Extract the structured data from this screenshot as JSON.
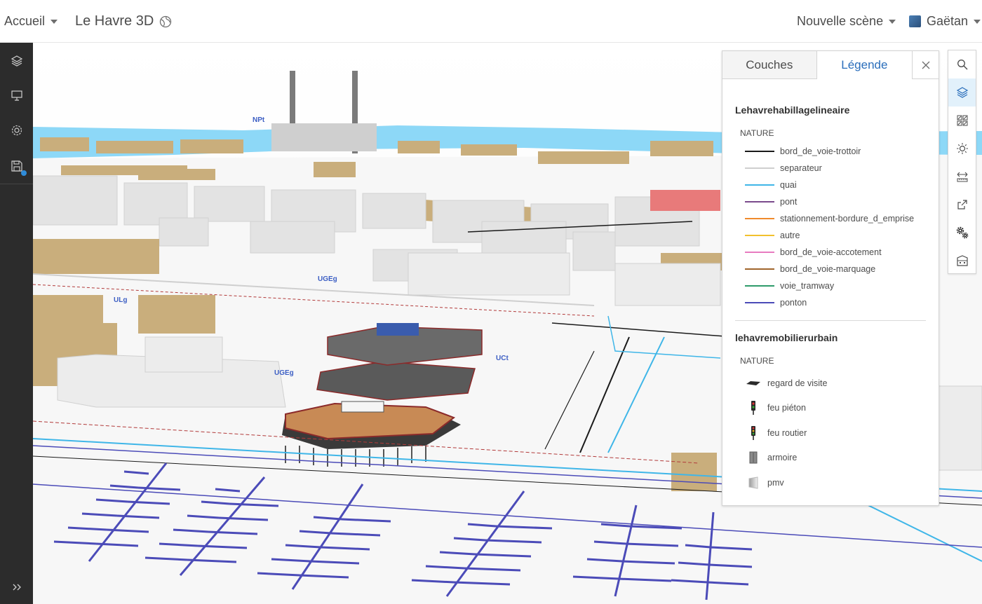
{
  "header": {
    "home_label": "Accueil",
    "app_title": "Le Havre 3D",
    "new_scene_label": "Nouvelle scène",
    "user_name": "Gaëtan"
  },
  "map": {
    "labels": [
      "NPt",
      "UGEg",
      "ULg",
      "UGEg",
      "UCt"
    ]
  },
  "panel": {
    "tab_layers": "Couches",
    "tab_legend": "Légende",
    "legend": [
      {
        "layer": "Lehavrehabillagelineaire",
        "field": "NATURE",
        "items": [
          {
            "label": "bord_de_voie-trottoir",
            "color": "#1a1a1a"
          },
          {
            "label": "separateur",
            "color": "#cfcfcf"
          },
          {
            "label": "quai",
            "color": "#3fb6e8"
          },
          {
            "label": "pont",
            "color": "#7a4a8c"
          },
          {
            "label": "stationnement-bordure_d_emprise",
            "color": "#f08a2c"
          },
          {
            "label": "autre",
            "color": "#f2c12e"
          },
          {
            "label": "bord_de_voie-accotement",
            "color": "#e87bc0"
          },
          {
            "label": "bord_de_voie-marquage",
            "color": "#a0652c"
          },
          {
            "label": "voie_tramway",
            "color": "#2e9b6a"
          },
          {
            "label": "ponton",
            "color": "#4b4bb8"
          }
        ]
      },
      {
        "layer": "lehavremobilierurbain",
        "field": "NATURE",
        "items": [
          {
            "label": "regard de visite",
            "icon": "manhole-icon"
          },
          {
            "label": "feu piéton",
            "icon": "pedestrian-light-icon"
          },
          {
            "label": "feu routier",
            "icon": "traffic-light-icon"
          },
          {
            "label": "armoire",
            "icon": "cabinet-icon"
          },
          {
            "label": "pmv",
            "icon": "sign-panel-icon"
          }
        ]
      }
    ]
  },
  "colors": {
    "accent": "#2a6ebb",
    "toolbar_dark": "#2c2c2c",
    "water": "#8dd8f7",
    "building_tan": "#c9ae7c",
    "building_gray": "#dedede"
  }
}
